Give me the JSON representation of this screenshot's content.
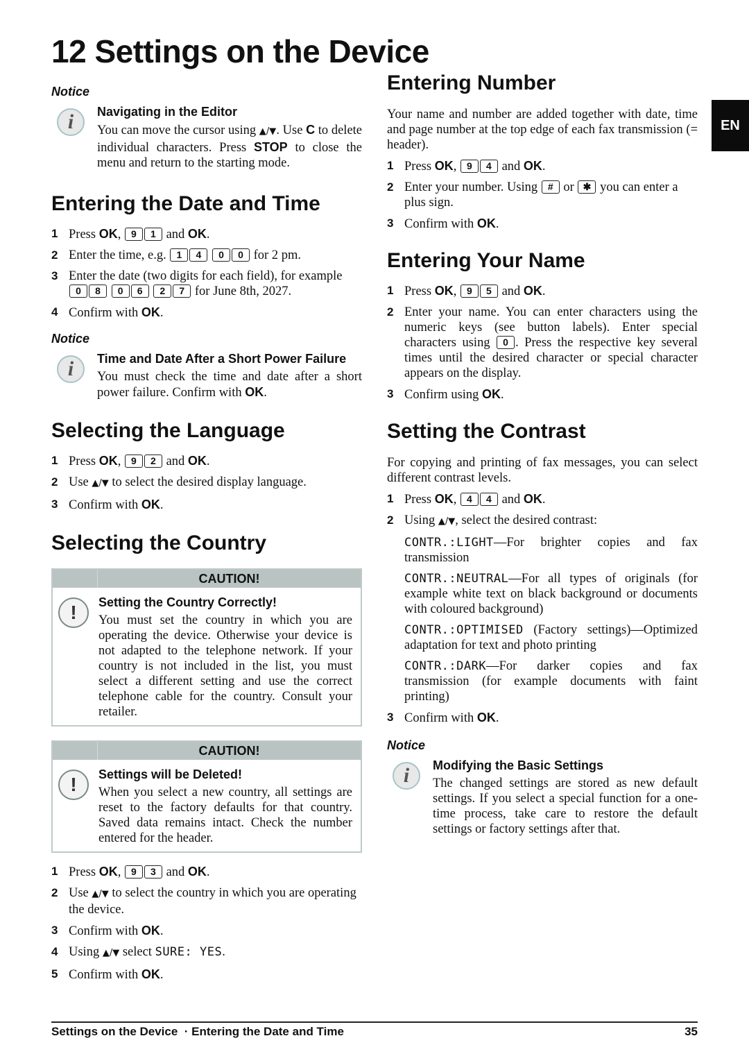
{
  "page_title": "12 Settings on the Device",
  "language_tab": "EN",
  "common": {
    "ok": "OK",
    "arrows": "▲/▼",
    "period": ".",
    "comma": ",",
    "and": " and "
  },
  "notice_editor": {
    "label": "Notice",
    "icon": "info-icon",
    "title": "Navigating in the Editor",
    "text_1": "You can move the cursor using ",
    "text_2": ". Use ",
    "key_c": "C",
    "text_3": " to delete individual characters. Press ",
    "key_stop": "STOP",
    "text_4": " to close the menu and return to the starting mode."
  },
  "date_time": {
    "heading": "Entering the Date and Time",
    "steps": [
      {
        "num": "1",
        "pre": "Press ",
        "keys": [
          "9",
          "1"
        ]
      },
      {
        "num": "2",
        "pre": "Enter the time, e.g. ",
        "keys": [
          "1",
          "4",
          "0",
          "0"
        ],
        "post": " for 2 pm."
      },
      {
        "num": "3",
        "pre": "Enter the date (two digits for each field), for example ",
        "keys": [
          "0",
          "8",
          "0",
          "6",
          "2",
          "7"
        ],
        "post": " for June 8th, 2027."
      },
      {
        "num": "4",
        "pre": "Confirm with "
      }
    ],
    "notice": {
      "label": "Notice",
      "icon": "info-icon",
      "title": "Time and Date After a Short Power Failure",
      "text": "You must check the time and date after a short power failure. Confirm with "
    }
  },
  "language": {
    "heading": "Selecting the Language",
    "steps": [
      {
        "num": "1",
        "pre": "Press ",
        "keys": [
          "9",
          "2"
        ]
      },
      {
        "num": "2",
        "pre": "Use ",
        "post": " to select the desired display language."
      },
      {
        "num": "3",
        "pre": "Confirm with "
      }
    ]
  },
  "country": {
    "heading": "Selecting the Country",
    "caution_1": {
      "label": "CAUTION!",
      "icon": "warning-icon",
      "title": "Setting the Country Correctly!",
      "text": "You must set the country in which you are operating the device. Otherwise your device is not adapted to the telephone network. If your country is not included in the list, you must select a different setting and use the correct telephone cable for the country. Consult your retailer."
    },
    "caution_2": {
      "label": "CAUTION!",
      "icon": "warning-icon",
      "title": "Settings will be Deleted!",
      "text": "When you select a new country, all settings are reset to the factory defaults for that country. Saved data remains intact. Check the number entered for the header."
    },
    "steps": [
      {
        "num": "1",
        "pre": "Press ",
        "keys": [
          "9",
          "3"
        ]
      },
      {
        "num": "2",
        "pre": "Use ",
        "post": " to select the country in which you are operating the device."
      },
      {
        "num": "3",
        "pre": "Confirm with "
      },
      {
        "num": "4",
        "pre": "Using ",
        "mid": " select ",
        "lcd": "SURE: YES"
      },
      {
        "num": "5",
        "pre": "Confirm with "
      }
    ]
  },
  "number": {
    "heading": "Entering Number",
    "intro": "Your name and number are added together with date, time and page number at the top edge of each fax transmission (= header).",
    "steps": [
      {
        "num": "1",
        "pre": "Press ",
        "keys": [
          "9",
          "4"
        ]
      },
      {
        "num": "2",
        "pre": "Enter your number. Using ",
        "key_a": "#",
        "mid": " or ",
        "key_b": "✱",
        "post": " you can enter a plus sign."
      },
      {
        "num": "3",
        "pre": "Confirm with "
      }
    ]
  },
  "name": {
    "heading": "Entering Your Name",
    "steps": [
      {
        "num": "1",
        "pre": "Press ",
        "keys": [
          "9",
          "5"
        ]
      },
      {
        "num": "2",
        "pre": "Enter your name. You can enter characters using the numeric keys (see button labels). Enter special characters using ",
        "key": "0",
        "post": ". Press the respective key several times until the desired character or special character appears on the display."
      },
      {
        "num": "3",
        "pre": "Confirm using "
      }
    ]
  },
  "contrast": {
    "heading": "Setting the Contrast",
    "intro": "For copying and printing of fax messages, you can select different contrast levels.",
    "steps": [
      {
        "num": "1",
        "pre": "Press ",
        "keys": [
          "4",
          "4"
        ]
      },
      {
        "num": "2",
        "pre": "Using ",
        "post": ", select the desired contrast:"
      },
      {
        "num": "3",
        "pre": "Confirm with "
      }
    ],
    "options": [
      {
        "lcd": "CONTR.:LIGHT",
        "text": "—For brighter copies and fax transmission"
      },
      {
        "lcd": "CONTR.:NEUTRAL",
        "text": "—For all types of originals (for example white text on black background or documents with coloured background)"
      },
      {
        "lcd": "CONTR.:OPTIMISED",
        "text": " (Factory settings)—Optimized adaptation for text and photo printing"
      },
      {
        "lcd": "CONTR.:DARK",
        "text": "—For darker copies and fax transmission (for example documents with faint printing)"
      }
    ],
    "notice": {
      "label": "Notice",
      "icon": "info-icon",
      "title": "Modifying the Basic Settings",
      "text": "The changed settings are stored as new default settings. If you select a special function for a one-time process, take care to restore the default settings or factory settings after that."
    }
  },
  "footer": {
    "breadcrumb": "Settings on the Device  · Entering the Date and Time",
    "page_number": "35"
  }
}
